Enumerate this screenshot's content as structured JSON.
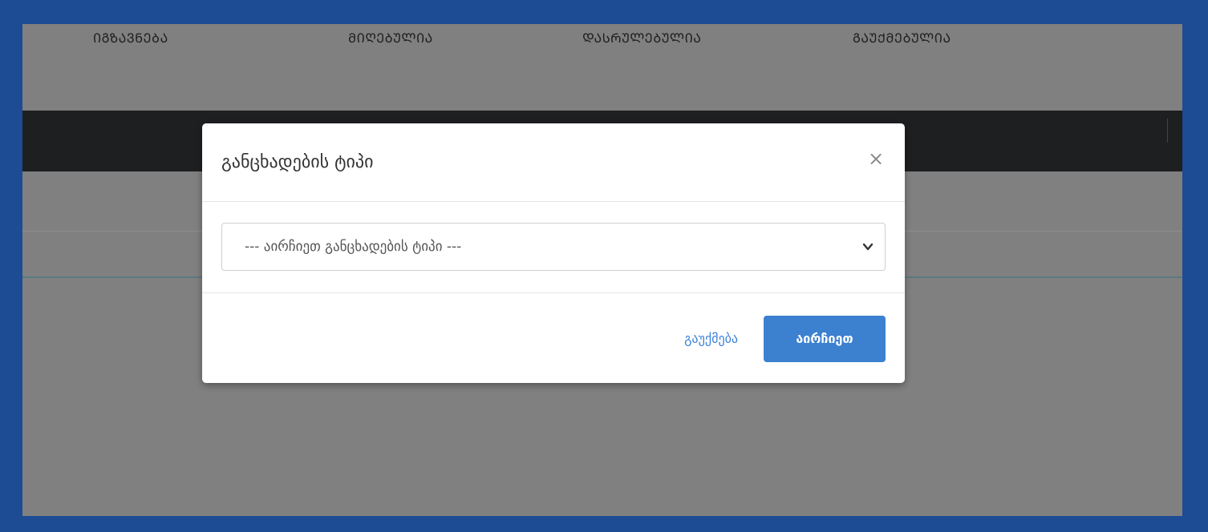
{
  "status_tabs": [
    {
      "label": "ᲘᲒᲖᲐᲕᲜᲔᲑᲐ"
    },
    {
      "label": "ᲛᲘᲦᲔᲑᲣᲚᲘᲐ"
    },
    {
      "label": "ᲓᲐᲡᲠᲣᲚᲔᲑᲣᲚᲘᲐ"
    },
    {
      "label": "ᲒᲐᲣᲥᲛᲔᲑᲣᲚᲘᲐ"
    }
  ],
  "modal": {
    "title": "განცხადების ტიპი",
    "close_glyph": "×",
    "select": {
      "selected_value": "--- აირჩიეთ განცხადების ტიპი ---"
    },
    "cancel_label": "გაუქმება",
    "select_label": "აირჩიეთ"
  },
  "colors": {
    "frame": "#1d4b94",
    "overlay": "#808080",
    "navbar": "#1d1f21",
    "primary_button": "#3c80d0",
    "link": "#3d82d6"
  },
  "icons": {
    "close": "close-icon",
    "dropdown": "chevron-down-icon"
  }
}
